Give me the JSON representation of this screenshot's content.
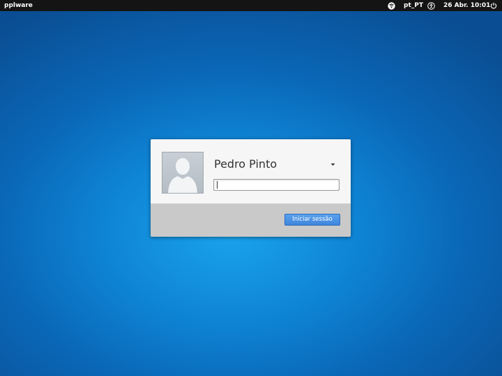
{
  "topbar": {
    "hostname": "pplware",
    "language": "pt_PT",
    "datetime": "26 Abr. 10:01",
    "icons": {
      "network": "network-icon",
      "accessibility": "accessibility-icon",
      "power": "power-icon"
    }
  },
  "login": {
    "username": "Pedro Pinto",
    "password_value": "",
    "button_label": "Iniciar sessão",
    "accent_color": "#3f86dc"
  },
  "colors": {
    "background": "#0f86d6",
    "topbar": "#141414"
  }
}
